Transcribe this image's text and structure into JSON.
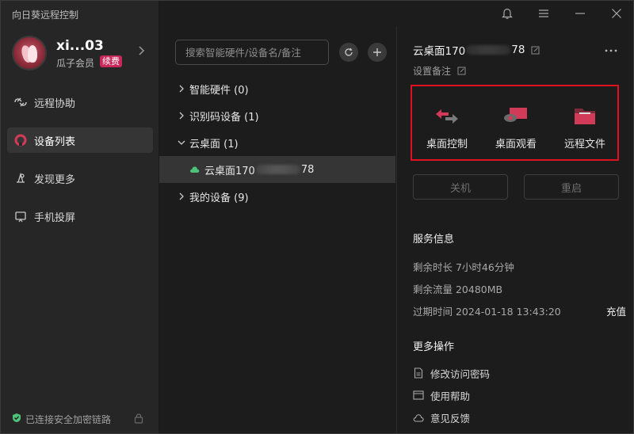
{
  "window": {
    "app_title": "向日葵远程控制"
  },
  "profile": {
    "username": "xi...03",
    "member": "瓜子会员",
    "renew_badge": "续费"
  },
  "nav": {
    "items": [
      {
        "label": "远程协助",
        "icon": "remote-assist-icon",
        "active": false
      },
      {
        "label": "设备列表",
        "icon": "device-list-icon",
        "active": true
      },
      {
        "label": "发现更多",
        "icon": "discover-icon",
        "active": false
      },
      {
        "label": "手机投屏",
        "icon": "screen-cast-icon",
        "active": false
      }
    ]
  },
  "status": {
    "secure_link": "已连接安全加密链路"
  },
  "middle": {
    "search_placeholder": "搜索智能硬件/设备名/备注",
    "tree": [
      {
        "label": "智能硬件 (0)",
        "expanded": false
      },
      {
        "label": "识别码设备 (1)",
        "expanded": false
      },
      {
        "label": "云桌面 (1)",
        "expanded": true
      },
      {
        "label": "我的设备 (9)",
        "expanded": false
      }
    ],
    "selected_device": {
      "prefix": "云桌面170",
      "suffix": "78"
    }
  },
  "device": {
    "title_prefix": "云桌面170",
    "title_suffix": "78",
    "note": "设置备注",
    "actions": [
      {
        "label": "桌面控制",
        "icon": "desktop-control-icon"
      },
      {
        "label": "桌面观看",
        "icon": "desktop-view-icon"
      },
      {
        "label": "远程文件",
        "icon": "remote-file-icon"
      }
    ],
    "shutdown": "关机",
    "restart": "重启"
  },
  "service": {
    "title": "服务信息",
    "remaining_time": "剩余时长 7小时46分钟",
    "remaining_traffic": "剩余流量 20480MB",
    "expire": "过期时间 2024-01-18 13:43:20",
    "recharge": "充值"
  },
  "more_ops": {
    "title": "更多操作",
    "items": [
      {
        "label": "修改访问密码",
        "icon": "document-icon"
      },
      {
        "label": "使用帮助",
        "icon": "help-book-icon"
      },
      {
        "label": "意见反馈",
        "icon": "feedback-cloud-icon"
      }
    ]
  },
  "colors": {
    "accent_red": "#e0101e",
    "brand_pink": "#d23b58",
    "badge": "#c8275a",
    "online_green": "#4ec27a"
  }
}
